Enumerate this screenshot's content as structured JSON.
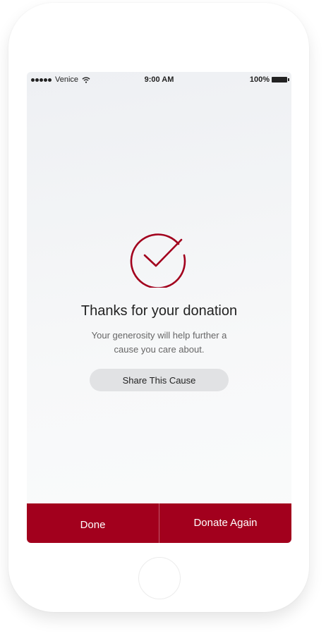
{
  "status_bar": {
    "carrier": "Venice",
    "time": "9:00 AM",
    "battery": "100%"
  },
  "confirmation": {
    "title": "Thanks for your donation",
    "message": "Your generosity will help further a cause you care about.",
    "share_label": "Share This Cause"
  },
  "actions": {
    "done_label": "Done",
    "donate_again_label": "Donate Again"
  },
  "colors": {
    "accent": "#a2001d",
    "share_button_bg": "#e1e2e4"
  },
  "icons": [
    "signal-dots-icon",
    "wifi-icon",
    "battery-icon",
    "checkmark-circle-icon"
  ]
}
